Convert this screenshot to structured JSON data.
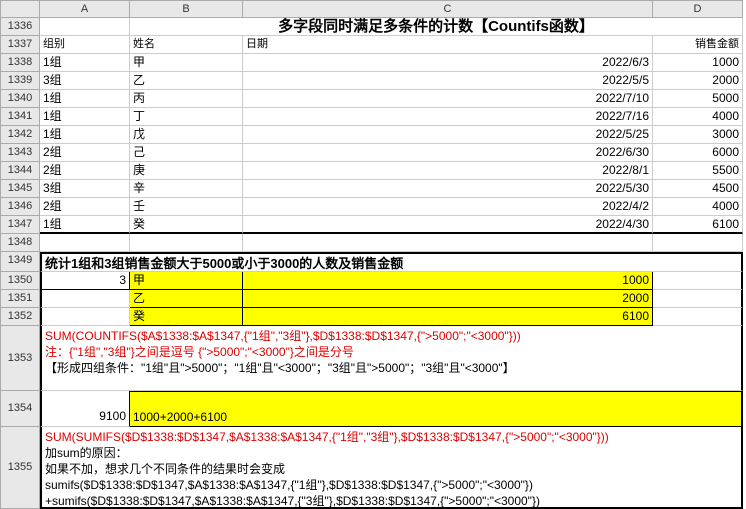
{
  "cols": [
    "A",
    "B",
    "C",
    "D"
  ],
  "rows": [
    "1336",
    "1337",
    "1338",
    "1339",
    "1340",
    "1341",
    "1342",
    "1343",
    "1344",
    "1345",
    "1346",
    "1347",
    "1348",
    "1349",
    "1350",
    "1351",
    "1352",
    "1353",
    "1354",
    "1355"
  ],
  "title": "多字段同时满足多条件的计数【Countifs函数】",
  "headers": {
    "group": "组别",
    "name": "姓名",
    "date": "日期",
    "amount": "销售金额"
  },
  "data": [
    {
      "g": "1组",
      "n": "甲",
      "d": "2022/6/3",
      "a": "1000"
    },
    {
      "g": "3组",
      "n": "乙",
      "d": "2022/5/5",
      "a": "2000"
    },
    {
      "g": "1组",
      "n": "丙",
      "d": "2022/7/10",
      "a": "5000"
    },
    {
      "g": "1组",
      "n": "丁",
      "d": "2022/7/16",
      "a": "4000"
    },
    {
      "g": "1组",
      "n": "戊",
      "d": "2022/5/25",
      "a": "3000"
    },
    {
      "g": "2组",
      "n": "己",
      "d": "2022/6/30",
      "a": "6000"
    },
    {
      "g": "2组",
      "n": "庚",
      "d": "2022/8/1",
      "a": "5500"
    },
    {
      "g": "3组",
      "n": "辛",
      "d": "2022/5/30",
      "a": "4500"
    },
    {
      "g": "2组",
      "n": "壬",
      "d": "2022/4/2",
      "a": "4000"
    },
    {
      "g": "1组",
      "n": "癸",
      "d": "2022/4/30",
      "a": "6100"
    }
  ],
  "subtitle": "统计1组和3组销售金额大于5000或小于3000的人数及销售金额",
  "result_count": "3",
  "yel_rows": [
    {
      "n": "甲",
      "a": "1000"
    },
    {
      "n": "乙",
      "a": "2000"
    },
    {
      "n": "癸",
      "a": "6100"
    }
  ],
  "block1_l1": "SUM(COUNTIFS($A$1338:$A$1347,{\"1组\",\"3组\"},$D$1338:$D$1347,{\">5000\";\"<3000\"}))",
  "block1_l2": "注：{\"1组\",\"3组\"}之间是逗号   {\">5000\";\"<3000\"}之间是分号",
  "block1_l3": "【形成四组条件：\"1组\"且\">5000\"；\"1组\"且\"<3000\"；\"3组\"且\">5000\"；\"3组\"且\"<3000\"】",
  "sum_val": "9100",
  "sum_expr": "1000+2000+6100",
  "block2_l1": "SUM(SUMIFS($D$1338:$D$1347,$A$1338:$A$1347,{\"1组\",\"3组\"},$D$1338:$D$1347,{\">5000\";\"<3000\"}))",
  "block2_l2": "加sum的原因：",
  "block2_l3": "如果不加，想求几个不同条件的结果时会变成",
  "block2_l4": "sumifs($D$1338:$D$1347,$A$1338:$A$1347,{\"1组\"},$D$1338:$D$1347,{\">5000\";\"<3000\"})",
  "block2_l5": "+sumifs($D$1338:$D$1347,$A$1338:$A$1347,{\"3组\"},$D$1338:$D$1347,{\">5000\";\"<3000\"})"
}
